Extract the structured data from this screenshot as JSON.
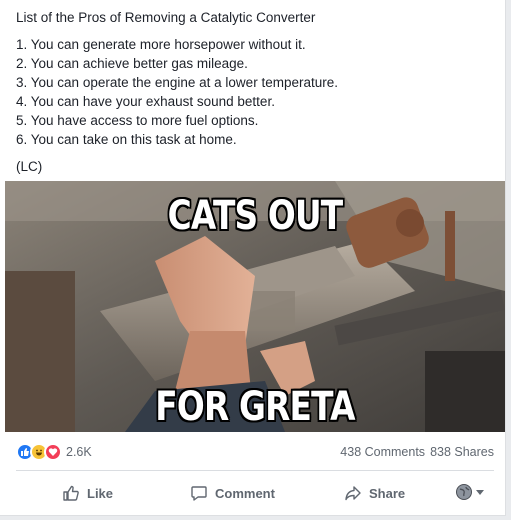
{
  "post": {
    "title": "List of the Pros of Removing a Catalytic Converter",
    "items": [
      "1. You can generate more horsepower without it.",
      "2. You can achieve better gas mileage.",
      "3. You can operate the engine at a lower temperature.",
      "4. You can have your exhaust sound better.",
      "5. You have access to more fuel options.",
      "6. You can take on this task at home."
    ],
    "signature": "(LC)"
  },
  "image": {
    "top_text": "CATS OUT",
    "bottom_text": "FOR GRETA"
  },
  "stats": {
    "reactions": [
      "like-icon",
      "haha-icon",
      "love-icon"
    ],
    "reaction_count": "2.6K",
    "comments": "438 Comments",
    "shares": "838 Shares"
  },
  "actions": {
    "like_label": "Like",
    "comment_label": "Comment",
    "share_label": "Share",
    "audience_icon": "globe-icon"
  },
  "colors": {
    "like": "#2078f4",
    "haha": "#f7c337",
    "love": "#f33e58",
    "action_text": "#606770"
  }
}
